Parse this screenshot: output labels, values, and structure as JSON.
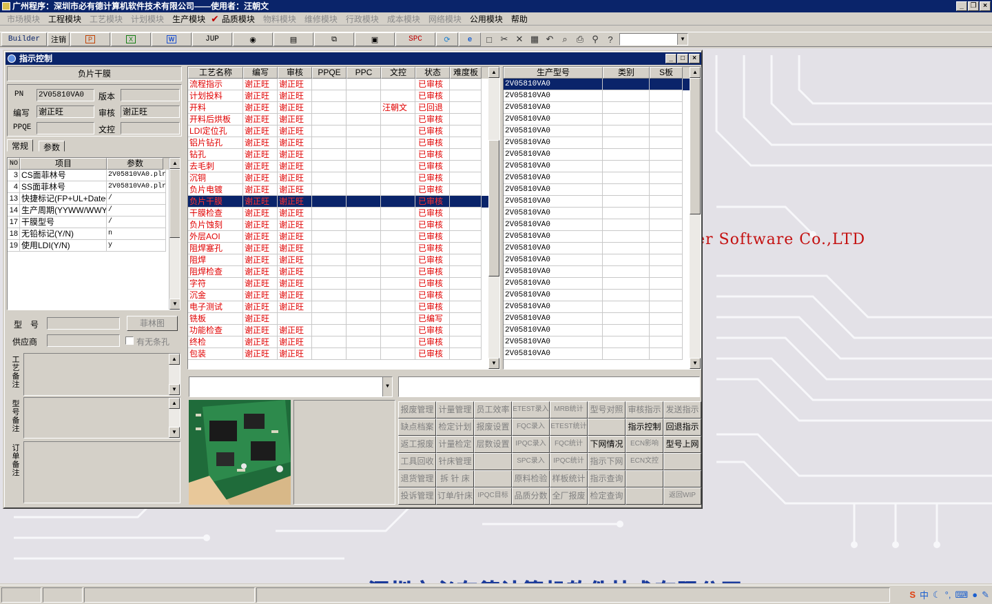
{
  "app": {
    "title": "广州程序：深圳市必有德计算机软件技术有限公司——使用者：汪朝文"
  },
  "menu": [
    {
      "label": "市场模块",
      "enabled": false
    },
    {
      "label": "工程模块",
      "enabled": true
    },
    {
      "label": "工艺模块",
      "enabled": false
    },
    {
      "label": "计划模块",
      "enabled": false
    },
    {
      "label": "生产模块",
      "enabled": true
    },
    {
      "label": "品质模块",
      "enabled": true
    },
    {
      "label": "物料模块",
      "enabled": false
    },
    {
      "label": "维修模块",
      "enabled": false
    },
    {
      "label": "行政模块",
      "enabled": false
    },
    {
      "label": "成本模块",
      "enabled": false
    },
    {
      "label": "网络模块",
      "enabled": false
    },
    {
      "label": "公用模块",
      "enabled": true
    },
    {
      "label": "帮助",
      "enabled": true
    }
  ],
  "toolbar": {
    "builder": "Builder",
    "logout": "注销",
    "jup": "JUP",
    "spc": "SPC"
  },
  "background": {
    "software_text": "er Software Co.,LTD",
    "company_name": "深圳市必有德计算机软件技术有限公司"
  },
  "window": {
    "title": "指示控制"
  },
  "left": {
    "section_title": "负片干膜",
    "pn_label": "PN",
    "pn_value": "2V05810VA0",
    "version_label": "版本",
    "version_value": "",
    "writer_label": "编写",
    "writer_value": "谢正旺",
    "reviewer_label": "审核",
    "reviewer_value": "谢正旺",
    "ppqe_label": "PPQE",
    "ppqe_value": "",
    "control_label": "文控",
    "control_value": "",
    "tabs": [
      "常规",
      "参数"
    ],
    "param_headers": [
      "NO",
      "项目",
      "参数"
    ],
    "params": [
      {
        "no": "3",
        "item": "CS面菲林号",
        "value": "2V05810VA0.plr"
      },
      {
        "no": "4",
        "item": "SS面菲林号",
        "value": "2V05810VA0.plr"
      },
      {
        "no": "13",
        "item": "快捷标记(FP+UL+DateC",
        "value": "/"
      },
      {
        "no": "14",
        "item": "生产周期(YYWW/WWYY)",
        "value": "/"
      },
      {
        "no": "17",
        "item": "干膜型号",
        "value": "/"
      },
      {
        "no": "18",
        "item": "无铅标记(Y/N)",
        "value": "n"
      },
      {
        "no": "19",
        "item": "使用LDI(Y/N)",
        "value": "y"
      }
    ],
    "model_label": "型　号",
    "film_button": "菲林图",
    "supplier_label": "供应商",
    "slot_checkbox": "有无条孔",
    "memo_labels": [
      "工艺备注",
      "型号备注",
      "订单备注"
    ]
  },
  "process": {
    "headers": [
      "工艺名称",
      "编写",
      "审核",
      "PPQE",
      "PPC",
      "文控",
      "状态",
      "难度板"
    ],
    "rows": [
      {
        "name": "流程指示",
        "writer": "谢正旺",
        "reviewer": "谢正旺",
        "ppqe": "",
        "ppc": "",
        "control": "",
        "status": "已审核"
      },
      {
        "name": "计划投料",
        "writer": "谢正旺",
        "reviewer": "谢正旺",
        "ppqe": "",
        "ppc": "",
        "control": "",
        "status": "已审核"
      },
      {
        "name": "开料",
        "writer": "谢正旺",
        "reviewer": "谢正旺",
        "ppqe": "",
        "ppc": "",
        "control": "汪朝文",
        "status": "已回退"
      },
      {
        "name": "开料后烘板",
        "writer": "谢正旺",
        "reviewer": "谢正旺",
        "ppqe": "",
        "ppc": "",
        "control": "",
        "status": "已审核"
      },
      {
        "name": "LDI定位孔",
        "writer": "谢正旺",
        "reviewer": "谢正旺",
        "ppqe": "",
        "ppc": "",
        "control": "",
        "status": "已审核"
      },
      {
        "name": "铝片钻孔",
        "writer": "谢正旺",
        "reviewer": "谢正旺",
        "ppqe": "",
        "ppc": "",
        "control": "",
        "status": "已审核"
      },
      {
        "name": "钻孔",
        "writer": "谢正旺",
        "reviewer": "谢正旺",
        "ppqe": "",
        "ppc": "",
        "control": "",
        "status": "已审核"
      },
      {
        "name": "去毛刺",
        "writer": "谢正旺",
        "reviewer": "谢正旺",
        "ppqe": "",
        "ppc": "",
        "control": "",
        "status": "已审核"
      },
      {
        "name": "沉铜",
        "writer": "谢正旺",
        "reviewer": "谢正旺",
        "ppqe": "",
        "ppc": "",
        "control": "",
        "status": "已审核"
      },
      {
        "name": "负片电镀",
        "writer": "谢正旺",
        "reviewer": "谢正旺",
        "ppqe": "",
        "ppc": "",
        "control": "",
        "status": "已审核"
      },
      {
        "name": "负片干膜",
        "writer": "谢正旺",
        "reviewer": "谢正旺",
        "ppqe": "",
        "ppc": "",
        "control": "",
        "status": "已审核",
        "selected": true
      },
      {
        "name": "干膜检查",
        "writer": "谢正旺",
        "reviewer": "谢正旺",
        "ppqe": "",
        "ppc": "",
        "control": "",
        "status": "已审核"
      },
      {
        "name": "负片蚀刻",
        "writer": "谢正旺",
        "reviewer": "谢正旺",
        "ppqe": "",
        "ppc": "",
        "control": "",
        "status": "已审核"
      },
      {
        "name": "外层AOI",
        "writer": "谢正旺",
        "reviewer": "谢正旺",
        "ppqe": "",
        "ppc": "",
        "control": "",
        "status": "已审核"
      },
      {
        "name": "阻焊塞孔",
        "writer": "谢正旺",
        "reviewer": "谢正旺",
        "ppqe": "",
        "ppc": "",
        "control": "",
        "status": "已审核"
      },
      {
        "name": "阻焊",
        "writer": "谢正旺",
        "reviewer": "谢正旺",
        "ppqe": "",
        "ppc": "",
        "control": "",
        "status": "已审核"
      },
      {
        "name": "阻焊检查",
        "writer": "谢正旺",
        "reviewer": "谢正旺",
        "ppqe": "",
        "ppc": "",
        "control": "",
        "status": "已审核"
      },
      {
        "name": "字符",
        "writer": "谢正旺",
        "reviewer": "谢正旺",
        "ppqe": "",
        "ppc": "",
        "control": "",
        "status": "已审核"
      },
      {
        "name": "沉金",
        "writer": "谢正旺",
        "reviewer": "谢正旺",
        "ppqe": "",
        "ppc": "",
        "control": "",
        "status": "已审核"
      },
      {
        "name": "电子测试",
        "writer": "谢正旺",
        "reviewer": "谢正旺",
        "ppqe": "",
        "ppc": "",
        "control": "",
        "status": "已审核"
      },
      {
        "name": "铣板",
        "writer": "谢正旺",
        "reviewer": "",
        "ppqe": "",
        "ppc": "",
        "control": "",
        "status": "已编写"
      },
      {
        "name": "功能检查",
        "writer": "谢正旺",
        "reviewer": "谢正旺",
        "ppqe": "",
        "ppc": "",
        "control": "",
        "status": "已审核"
      },
      {
        "name": "终检",
        "writer": "谢正旺",
        "reviewer": "谢正旺",
        "ppqe": "",
        "ppc": "",
        "control": "",
        "status": "已审核"
      },
      {
        "name": "包装",
        "writer": "谢正旺",
        "reviewer": "谢正旺",
        "ppqe": "",
        "ppc": "",
        "control": "",
        "status": "已审核"
      }
    ]
  },
  "models": {
    "headers": [
      "生产型号",
      "类别",
      "S板"
    ],
    "rows": [
      "2V05810VA0",
      "2V05810VA0",
      "2V05810VA0",
      "2V05810VA0",
      "2V05810VA0",
      "2V05810VA0",
      "2V05810VA0",
      "2V05810VA0",
      "2V05810VA0",
      "2V05810VA0",
      "2V05810VA0",
      "2V05810VA0",
      "2V05810VA0",
      "2V05810VA0",
      "2V05810VA0",
      "2V05810VA0",
      "2V05810VA0",
      "2V05810VA0",
      "2V05810VA0",
      "2V05810VA0",
      "2V05810VA0",
      "2V05810VA0",
      "2V05810VA0",
      "2V05810VA0"
    ]
  },
  "buttons": [
    [
      {
        "label": "报废管理",
        "enabled": false
      },
      {
        "label": "计量管理",
        "enabled": false
      },
      {
        "label": "员工效率",
        "enabled": false
      },
      {
        "label": "ETEST录入",
        "enabled": false
      },
      {
        "label": "MRB统计",
        "enabled": false
      },
      {
        "label": "型号对照",
        "enabled": false
      },
      {
        "label": "审核指示",
        "enabled": false
      },
      {
        "label": "发送指示",
        "enabled": false
      }
    ],
    [
      {
        "label": "缺点档案",
        "enabled": false
      },
      {
        "label": "检定计划",
        "enabled": false
      },
      {
        "label": "报废设置",
        "enabled": false
      },
      {
        "label": "FQC录入",
        "enabled": false
      },
      {
        "label": "ETEST统计",
        "enabled": false
      },
      {
        "label": "",
        "enabled": false
      },
      {
        "label": "指示控制",
        "enabled": true
      },
      {
        "label": "回退指示",
        "enabled": true
      }
    ],
    [
      {
        "label": "返工报废",
        "enabled": false
      },
      {
        "label": "计量检定",
        "enabled": false
      },
      {
        "label": "层数设置",
        "enabled": false
      },
      {
        "label": "IPQC录入",
        "enabled": false
      },
      {
        "label": "FQC统计",
        "enabled": false
      },
      {
        "label": "下网情况",
        "enabled": true
      },
      {
        "label": "ECN影响",
        "enabled": false
      },
      {
        "label": "型号上网",
        "enabled": true
      }
    ],
    [
      {
        "label": "工具回收",
        "enabled": false
      },
      {
        "label": "针床管理",
        "enabled": false
      },
      {
        "label": "",
        "enabled": false
      },
      {
        "label": "SPC录入",
        "enabled": false
      },
      {
        "label": "IPQC统计",
        "enabled": false
      },
      {
        "label": "指示下网",
        "enabled": false
      },
      {
        "label": "ECN文控",
        "enabled": false
      },
      {
        "label": "",
        "enabled": false
      }
    ],
    [
      {
        "label": "退货管理",
        "enabled": false
      },
      {
        "label": "拆 针 床",
        "enabled": false
      },
      {
        "label": "",
        "enabled": false
      },
      {
        "label": "原料检验",
        "enabled": false
      },
      {
        "label": "样板统计",
        "enabled": false
      },
      {
        "label": "指示查询",
        "enabled": false
      },
      {
        "label": "",
        "enabled": false
      },
      {
        "label": "",
        "enabled": false
      }
    ],
    [
      {
        "label": "投诉管理",
        "enabled": false
      },
      {
        "label": "订单/针床",
        "enabled": false
      },
      {
        "label": "IPQC目标",
        "enabled": false
      },
      {
        "label": "品质分数",
        "enabled": false
      },
      {
        "label": "全厂报废",
        "enabled": false
      },
      {
        "label": "检定查询",
        "enabled": false
      },
      {
        "label": "",
        "enabled": false
      },
      {
        "label": "返回WIP",
        "enabled": false
      }
    ]
  ],
  "tray": {
    "ime": "中"
  },
  "colors": {
    "title_bg": "#0a246a",
    "select_bg": "#0a246a",
    "red_text": "#e00000",
    "bg_canvas": "#e3e1e7"
  }
}
